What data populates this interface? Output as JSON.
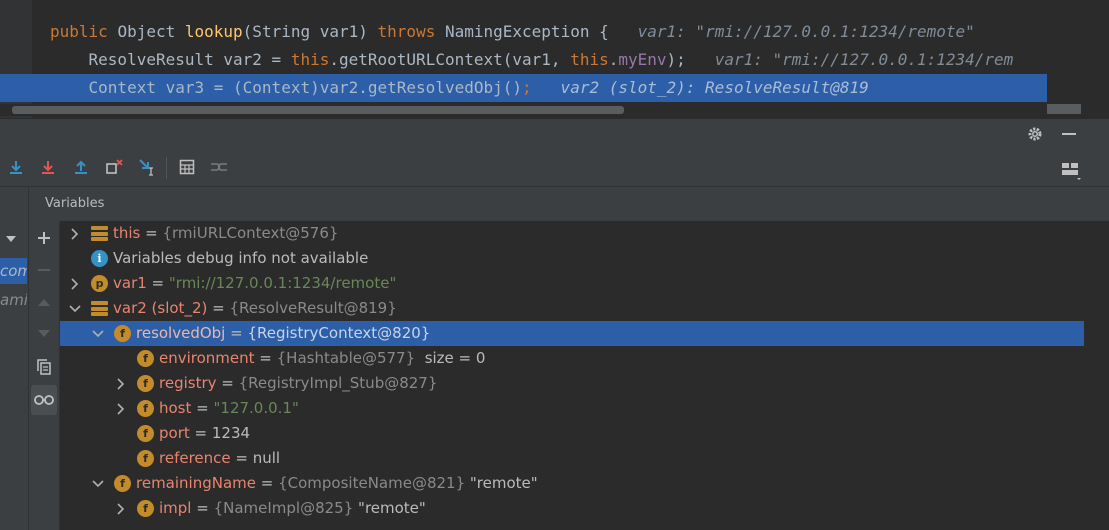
{
  "editor": {
    "lines": [
      {
        "parts": [
          {
            "t": "public ",
            "c": "kw"
          },
          {
            "t": "Object ",
            "c": ""
          },
          {
            "t": "lookup",
            "c": "fn"
          },
          {
            "t": "(String var1) ",
            "c": ""
          },
          {
            "t": "throws ",
            "c": "kw"
          },
          {
            "t": "NamingException {",
            "c": ""
          },
          {
            "t": "   var1: \"rmi://127.0.0.1:1234/remote\"",
            "c": "hint"
          }
        ]
      },
      {
        "parts": [
          {
            "t": "    ResolveResult var2 = ",
            "c": ""
          },
          {
            "t": "this",
            "c": "kw"
          },
          {
            "t": ".getRootURLContext(var1, ",
            "c": ""
          },
          {
            "t": "this",
            "c": "kw"
          },
          {
            "t": ".",
            "c": ""
          },
          {
            "t": "myEnv",
            "c": "fld"
          },
          {
            "t": ");",
            "c": ""
          },
          {
            "t": "   var1: \"rmi://127.0.0.1:1234/rem",
            "c": "hint"
          }
        ]
      },
      {
        "current": true,
        "parts": [
          {
            "t": "    Context var3 = (Context)var2.getResolvedObj()",
            "c": ""
          },
          {
            "t": ";",
            "c": "kw"
          },
          {
            "t": "   var2 (slot_2): ResolveResult@819",
            "c": "hint"
          }
        ]
      }
    ]
  },
  "toolbar": {
    "icons": [
      "step-over-icon",
      "step-into-icon",
      "force-step-into-icon",
      "step-out-icon",
      "drop-frame-icon",
      "run-to-cursor-icon",
      "evaluate-expression-icon",
      "trace-current-stream-icon"
    ]
  },
  "header_icons": [
    "settings-gear-icon",
    "minimize-icon",
    "layout-icon"
  ],
  "frames_stub": [
    "com",
    "ami"
  ],
  "variables": {
    "title": "Variables",
    "side_buttons": [
      "add-watch-icon",
      "remove-watch-icon",
      "move-up-icon",
      "move-down-icon",
      "copy-icon",
      "show-watches-icon"
    ],
    "rows": [
      {
        "indent": 0,
        "arrow": "right",
        "icon": "stack",
        "name": "this",
        "eq": " = ",
        "type": "{rmiURLContext@576}",
        "value": "",
        "value_kind": ""
      },
      {
        "indent": 0,
        "arrow": "",
        "icon": "info",
        "name": "",
        "eq": "",
        "type": "",
        "value": "Variables debug info not available",
        "value_kind": "plain"
      },
      {
        "indent": 0,
        "arrow": "right",
        "icon": "p",
        "name": "var1",
        "eq": " = ",
        "type": "",
        "value": "\"rmi://127.0.0.1:1234/remote\"",
        "value_kind": "str"
      },
      {
        "indent": 0,
        "arrow": "down",
        "icon": "stack",
        "name": "var2 (slot_2)",
        "eq": " = ",
        "type": "{ResolveResult@819}",
        "value": "",
        "value_kind": ""
      },
      {
        "indent": 1,
        "arrow": "down",
        "icon": "f",
        "name": "resolvedObj",
        "eq": " = ",
        "type": "{RegistryContext@820}",
        "value": "",
        "value_kind": "",
        "selected": true
      },
      {
        "indent": 2,
        "arrow": "",
        "icon": "f",
        "name": "environment",
        "eq": " = ",
        "type": "{Hashtable@577}",
        "value": "  size = 0",
        "value_kind": "plain"
      },
      {
        "indent": 2,
        "arrow": "right",
        "icon": "f",
        "name": "registry",
        "eq": " = ",
        "type": "{RegistryImpl_Stub@827}",
        "value": "",
        "value_kind": ""
      },
      {
        "indent": 2,
        "arrow": "right",
        "icon": "f",
        "name": "host",
        "eq": " = ",
        "type": "",
        "value": "\"127.0.0.1\"",
        "value_kind": "str"
      },
      {
        "indent": 2,
        "arrow": "",
        "icon": "f",
        "name": "port",
        "eq": " = ",
        "type": "",
        "value": "1234",
        "value_kind": "plain"
      },
      {
        "indent": 2,
        "arrow": "",
        "icon": "f",
        "name": "reference",
        "eq": " = ",
        "type": "",
        "value": "null",
        "value_kind": "plain"
      },
      {
        "indent": 1,
        "arrow": "down",
        "icon": "f",
        "name": "remainingName",
        "eq": " = ",
        "type": "{CompositeName@821}",
        "value": " \"remote\"",
        "value_kind": "plain"
      },
      {
        "indent": 2,
        "arrow": "right",
        "icon": "f",
        "name": "impl",
        "eq": " = ",
        "type": "{NameImpl@825}",
        "value": " \"remote\"",
        "value_kind": "plain"
      }
    ]
  }
}
